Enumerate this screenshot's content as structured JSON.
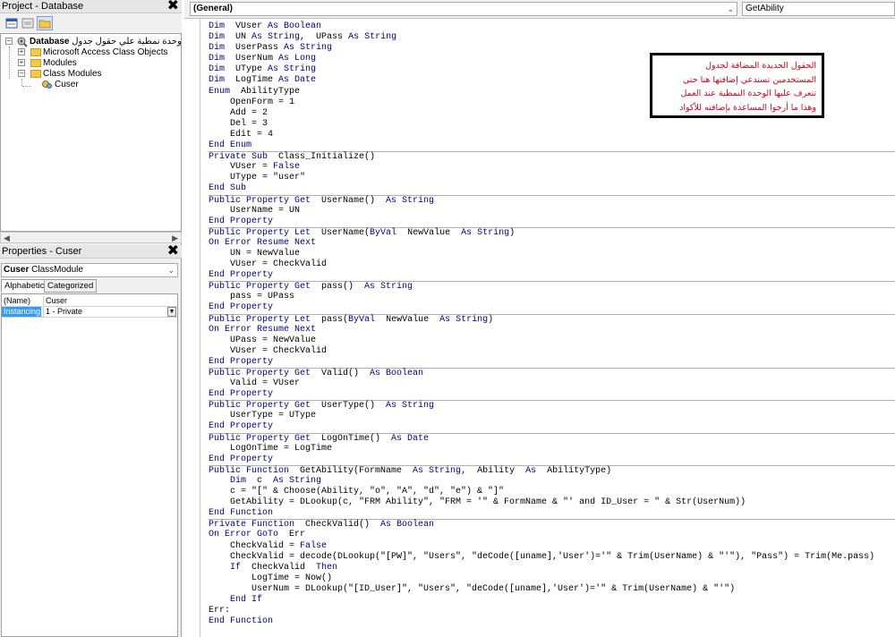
{
  "project_panel": {
    "title": "Project - Database",
    "close_glyph": "✖",
    "toolbar": [
      "view-code-icon",
      "view-object-icon",
      "toggle-folders-icon"
    ],
    "tree": {
      "root_label": "Database (وحدة نمطية علي حقول جدول",
      "root_bold": "Database",
      "root_suffix": "(وحدة نمطية علي حقول جدول",
      "nodes": [
        {
          "label": "Microsoft Access Class Objects",
          "expander": "+"
        },
        {
          "label": "Modules",
          "expander": "+"
        },
        {
          "label": "Class Modules",
          "expander": "−"
        }
      ],
      "leaf": "Cuser"
    }
  },
  "properties_panel": {
    "title": "Properties - Cuser",
    "close_glyph": "✖",
    "object_name": "Cuser",
    "object_type": "ClassModule",
    "tabs": [
      "Alphabetic",
      "Categorized"
    ],
    "rows": [
      {
        "name": "(Name)",
        "value": "Cuser"
      },
      {
        "name": "Instancing",
        "value": "1 - Private"
      }
    ]
  },
  "code_window": {
    "object_combo": "(General)",
    "proc_combo": "GetAbility",
    "lines": [
      {
        "indent": 0,
        "sep": false,
        "parts": [
          [
            "kw",
            "Dim"
          ],
          [
            "",
            "  VUser "
          ],
          [
            "kw",
            "As Boolean"
          ]
        ]
      },
      {
        "indent": 0,
        "sep": false,
        "parts": [
          [
            "kw",
            "Dim"
          ],
          [
            "",
            "  UN "
          ],
          [
            "kw",
            "As String"
          ],
          [
            "",
            ",  UPass "
          ],
          [
            "kw",
            "As String"
          ]
        ]
      },
      {
        "indent": 0,
        "sep": false,
        "parts": [
          [
            "kw",
            "Dim"
          ],
          [
            "",
            "  UserPass "
          ],
          [
            "kw",
            "As String"
          ]
        ]
      },
      {
        "indent": 0,
        "sep": false,
        "parts": [
          [
            "kw",
            "Dim"
          ],
          [
            "",
            "  UserNum "
          ],
          [
            "kw",
            "As Long"
          ]
        ]
      },
      {
        "indent": 0,
        "sep": false,
        "parts": [
          [
            "kw",
            "Dim"
          ],
          [
            "",
            "  UType "
          ],
          [
            "kw",
            "As String"
          ]
        ]
      },
      {
        "indent": 0,
        "sep": false,
        "parts": [
          [
            "kw",
            "Dim"
          ],
          [
            "",
            "  LogTime "
          ],
          [
            "kw",
            "As Date"
          ]
        ]
      },
      {
        "indent": 0,
        "sep": false,
        "parts": [
          [
            "kw",
            "Enum"
          ],
          [
            "",
            "  AbilityType"
          ]
        ]
      },
      {
        "indent": 1,
        "sep": false,
        "parts": [
          [
            "",
            "OpenForm = 1"
          ]
        ]
      },
      {
        "indent": 1,
        "sep": false,
        "parts": [
          [
            "",
            "Add = 2"
          ]
        ]
      },
      {
        "indent": 1,
        "sep": false,
        "parts": [
          [
            "",
            "Del = 3"
          ]
        ]
      },
      {
        "indent": 1,
        "sep": false,
        "parts": [
          [
            "",
            "Edit = 4"
          ]
        ]
      },
      {
        "indent": 0,
        "sep": false,
        "parts": [
          [
            "kw",
            "End Enum"
          ]
        ]
      },
      {
        "indent": 0,
        "sep": true,
        "parts": [
          [
            "kw",
            "Private Sub"
          ],
          [
            "",
            "  Class_Initialize()"
          ]
        ]
      },
      {
        "indent": 1,
        "sep": false,
        "parts": [
          [
            "",
            "VUser = "
          ],
          [
            "kw",
            "False"
          ]
        ]
      },
      {
        "indent": 1,
        "sep": false,
        "parts": [
          [
            "",
            "UType = \"user\""
          ]
        ]
      },
      {
        "indent": 0,
        "sep": false,
        "parts": [
          [
            "kw",
            "End Sub"
          ]
        ]
      },
      {
        "indent": 0,
        "sep": true,
        "parts": [
          [
            "kw",
            "Public Property Get"
          ],
          [
            "",
            "  UserName()  "
          ],
          [
            "kw",
            "As String"
          ]
        ]
      },
      {
        "indent": 1,
        "sep": false,
        "parts": [
          [
            "",
            "UserName = UN"
          ]
        ]
      },
      {
        "indent": 0,
        "sep": false,
        "parts": [
          [
            "kw",
            "End Property"
          ]
        ]
      },
      {
        "indent": 0,
        "sep": true,
        "parts": [
          [
            "kw",
            "Public Property Let"
          ],
          [
            "",
            "  UserName("
          ],
          [
            "kw",
            "ByVal"
          ],
          [
            "",
            "  NewValue  "
          ],
          [
            "kw",
            "As String"
          ],
          [
            "",
            ")"
          ]
        ]
      },
      {
        "indent": 0,
        "sep": false,
        "parts": [
          [
            "kw",
            "On Error Resume Next"
          ]
        ]
      },
      {
        "indent": 1,
        "sep": false,
        "parts": [
          [
            "",
            "UN = NewValue"
          ]
        ]
      },
      {
        "indent": 1,
        "sep": false,
        "parts": [
          [
            "",
            "VUser = CheckValid"
          ]
        ]
      },
      {
        "indent": 0,
        "sep": false,
        "parts": [
          [
            "kw",
            "End Property"
          ]
        ]
      },
      {
        "indent": 0,
        "sep": true,
        "parts": [
          [
            "kw",
            "Public Property Get"
          ],
          [
            "",
            "  pass()  "
          ],
          [
            "kw",
            "As String"
          ]
        ]
      },
      {
        "indent": 1,
        "sep": false,
        "parts": [
          [
            "",
            "pass = UPass"
          ]
        ]
      },
      {
        "indent": 0,
        "sep": false,
        "parts": [
          [
            "kw",
            "End Property"
          ]
        ]
      },
      {
        "indent": 0,
        "sep": true,
        "parts": [
          [
            "kw",
            "Public Property Let"
          ],
          [
            "",
            "  pass("
          ],
          [
            "kw",
            "ByVal"
          ],
          [
            "",
            "  NewValue  "
          ],
          [
            "kw",
            "As String"
          ],
          [
            "",
            ")"
          ]
        ]
      },
      {
        "indent": 0,
        "sep": false,
        "parts": [
          [
            "kw",
            "On Error Resume Next"
          ]
        ]
      },
      {
        "indent": 1,
        "sep": false,
        "parts": [
          [
            "",
            "UPass = NewValue"
          ]
        ]
      },
      {
        "indent": 1,
        "sep": false,
        "parts": [
          [
            "",
            "VUser = CheckValid"
          ]
        ]
      },
      {
        "indent": 0,
        "sep": false,
        "parts": [
          [
            "kw",
            "End Property"
          ]
        ]
      },
      {
        "indent": 0,
        "sep": true,
        "parts": [
          [
            "kw",
            "Public Property Get"
          ],
          [
            "",
            "  Valid()  "
          ],
          [
            "kw",
            "As Boolean"
          ]
        ]
      },
      {
        "indent": 1,
        "sep": false,
        "parts": [
          [
            "",
            "Valid = VUser"
          ]
        ]
      },
      {
        "indent": 0,
        "sep": false,
        "parts": [
          [
            "kw",
            "End Property"
          ]
        ]
      },
      {
        "indent": 0,
        "sep": true,
        "parts": [
          [
            "kw",
            "Public Property Get"
          ],
          [
            "",
            "  UserType()  "
          ],
          [
            "kw",
            "As String"
          ]
        ]
      },
      {
        "indent": 1,
        "sep": false,
        "parts": [
          [
            "",
            "UserType = UType"
          ]
        ]
      },
      {
        "indent": 0,
        "sep": false,
        "parts": [
          [
            "kw",
            "End Property"
          ]
        ]
      },
      {
        "indent": 0,
        "sep": true,
        "parts": [
          [
            "kw",
            "Public Property Get"
          ],
          [
            "",
            "  LogOnTime()  "
          ],
          [
            "kw",
            "As Date"
          ]
        ]
      },
      {
        "indent": 1,
        "sep": false,
        "parts": [
          [
            "",
            "LogOnTime = LogTime"
          ]
        ]
      },
      {
        "indent": 0,
        "sep": false,
        "parts": [
          [
            "kw",
            "End Property"
          ]
        ]
      },
      {
        "indent": 0,
        "sep": true,
        "parts": [
          [
            "kw",
            "Public Function"
          ],
          [
            "",
            "  GetAbility(FormName  "
          ],
          [
            "kw",
            "As String"
          ],
          [
            "",
            ",  Ability  "
          ],
          [
            "kw",
            "As"
          ],
          [
            "",
            "  AbilityType)"
          ]
        ]
      },
      {
        "indent": 1,
        "sep": false,
        "parts": [
          [
            "kw",
            "Dim"
          ],
          [
            "",
            "  c  "
          ],
          [
            "kw",
            "As String"
          ]
        ]
      },
      {
        "indent": 1,
        "sep": false,
        "parts": [
          [
            "",
            "c = \"[\" & Choose(Ability, \"o\", \"A\", \"d\", \"e\") & \"]\""
          ]
        ]
      },
      {
        "indent": 1,
        "sep": false,
        "parts": [
          [
            "",
            "GetAbility = DLookup(c, \"FRM Ability\", \"FRM = '\" & FormName & \"' and ID_User = \" & Str(UserNum))"
          ]
        ]
      },
      {
        "indent": 0,
        "sep": false,
        "parts": [
          [
            "kw",
            "End Function"
          ]
        ]
      },
      {
        "indent": 0,
        "sep": true,
        "parts": [
          [
            "kw",
            "Private Function"
          ],
          [
            "",
            "  CheckValid()  "
          ],
          [
            "kw",
            "As Boolean"
          ]
        ]
      },
      {
        "indent": 0,
        "sep": false,
        "parts": [
          [
            "kw",
            "On Error GoTo"
          ],
          [
            "",
            "  Err"
          ]
        ]
      },
      {
        "indent": 1,
        "sep": false,
        "parts": [
          [
            "",
            "CheckValid = "
          ],
          [
            "kw",
            "False"
          ]
        ]
      },
      {
        "indent": 1,
        "sep": false,
        "parts": [
          [
            "",
            "CheckValid = decode(DLookup(\"[PW]\", \"Users\", \"deCode([uname],'User')='\" & Trim(UserName) & \"'\"), \"Pass\") = Trim(Me.pass)"
          ]
        ]
      },
      {
        "indent": 1,
        "sep": false,
        "parts": [
          [
            "kw",
            "If"
          ],
          [
            "",
            "  CheckValid  "
          ],
          [
            "kw",
            "Then"
          ]
        ]
      },
      {
        "indent": 2,
        "sep": false,
        "parts": [
          [
            "",
            "LogTime = Now()"
          ]
        ]
      },
      {
        "indent": 2,
        "sep": false,
        "parts": [
          [
            "",
            "UserNum = DLookup(\"[ID_User]\", \"Users\", \"deCode([uname],'User')='\" & Trim(UserName) & \"'\")"
          ]
        ]
      },
      {
        "indent": 1,
        "sep": false,
        "parts": [
          [
            "kw",
            "End If"
          ]
        ]
      },
      {
        "indent": 0,
        "sep": false,
        "parts": [
          [
            "",
            "Err:"
          ]
        ]
      },
      {
        "indent": 0,
        "sep": false,
        "parts": [
          [
            "kw",
            "End Function"
          ]
        ]
      }
    ]
  },
  "annotation": {
    "lines": [
      "الحقول الجديدة المضافة لجدول",
      "المستخدمين تستدعي إضافتها هنا حتي",
      "تتعرف عليها الوحدة  النمطية عند العمل",
      "وهذا ما أرجوا المساعدة بإضافته للأكواد"
    ]
  },
  "colors": {
    "keyword": "#00008b",
    "annotation_text": "#e0001a",
    "selection": "#3399ff"
  }
}
